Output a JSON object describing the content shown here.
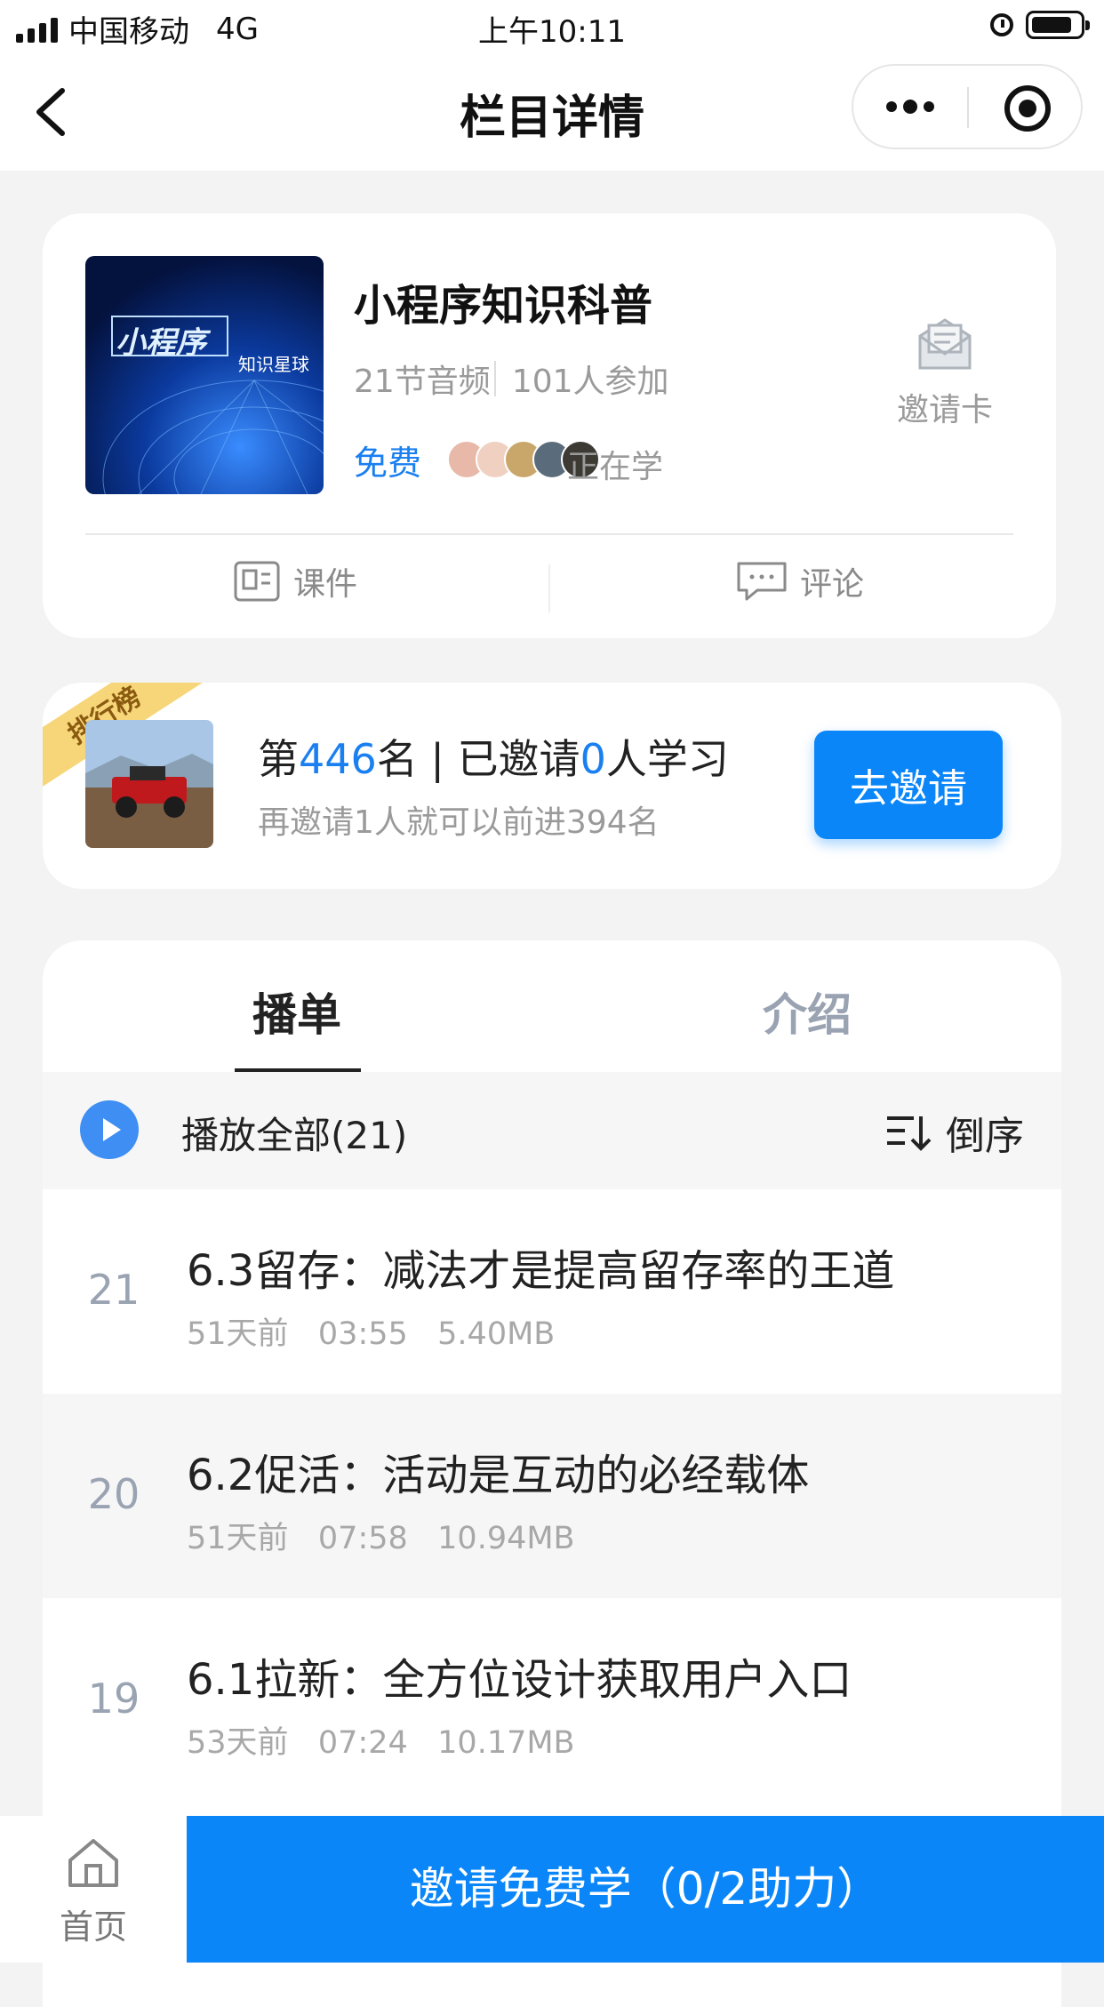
{
  "status_bar": {
    "carrier": "中国移动",
    "network": "4G",
    "time": "上午10:11"
  },
  "nav": {
    "title": "栏目详情"
  },
  "column": {
    "cover_title": "小程序",
    "cover_subtitle": "知识星球",
    "title": "小程序知识科普",
    "lessons": "21节音频",
    "participants": "101人参加",
    "price": "免费",
    "studying": "正在学",
    "invite_card_label": "邀请卡",
    "tabs": {
      "courseware": "课件",
      "comments": "评论"
    }
  },
  "ranking": {
    "ribbon": "排行榜",
    "rank_prefix": "第",
    "rank_value": "446",
    "rank_suffix": "名 | 已邀请",
    "invited_value": "0",
    "invited_suffix": "人学习",
    "subtitle": "再邀请1人就可以前进394名",
    "button": "去邀请"
  },
  "list": {
    "tabs": [
      "播单",
      "介绍"
    ],
    "play_all": "播放全部(21)",
    "sort": "倒序",
    "items": [
      {
        "num": "21",
        "title": "6.3留存：减法才是提高留存率的王道",
        "meta": "51天前   03:55   5.40MB"
      },
      {
        "num": "20",
        "title": "6.2促活：活动是互动的必经载体",
        "meta": "51天前   07:58   10.94MB"
      },
      {
        "num": "19",
        "title": "6.1拉新：全方位设计获取用户入口",
        "meta": "53天前   07:24   10.17MB"
      }
    ]
  },
  "bottom": {
    "home": "首页",
    "cta": "邀请免费学（0/2助力）"
  },
  "colors": {
    "accent": "#0a86f8",
    "link": "#1a7ff0",
    "ribbon": "#f7d679"
  }
}
